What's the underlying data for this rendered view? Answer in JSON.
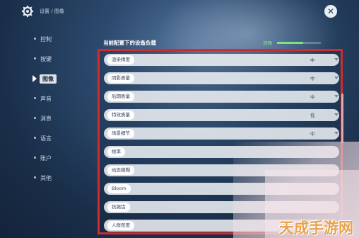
{
  "header": {
    "breadcrumb": "设置 / 图像",
    "close_glyph": "✕"
  },
  "sidebar": {
    "items": [
      {
        "label": "控制",
        "active": false
      },
      {
        "label": "按键",
        "active": false
      },
      {
        "label": "图像",
        "active": true
      },
      {
        "label": "声音",
        "active": false
      },
      {
        "label": "消息",
        "active": false
      },
      {
        "label": "语言",
        "active": false
      },
      {
        "label": "账户",
        "active": false
      },
      {
        "label": "其他",
        "active": false
      }
    ]
  },
  "main": {
    "section_title": "当前配置下的设备负载",
    "load_label": "流畅",
    "load_level": 0.6,
    "settings": [
      {
        "name": "渲染精度",
        "value": "中",
        "dropdown": true
      },
      {
        "name": "阴影质量",
        "value": "中",
        "dropdown": true
      },
      {
        "name": "后期质量",
        "value": "中",
        "dropdown": true
      },
      {
        "name": "特效质量",
        "value": "低",
        "dropdown": true
      },
      {
        "name": "场景细节",
        "value": "中",
        "dropdown": true
      },
      {
        "name": "帧率",
        "value": "",
        "dropdown": false
      },
      {
        "name": "动态模糊",
        "value": "",
        "dropdown": false
      },
      {
        "name": "Bloom",
        "value": "",
        "dropdown": false
      },
      {
        "name": "抗锯齿",
        "value": "",
        "dropdown": false
      },
      {
        "name": "人群密度",
        "value": "",
        "dropdown": false
      }
    ]
  },
  "watermark": "天成手游网",
  "colors": {
    "highlight_border": "#d22b2b",
    "load_bar": "#7fe07f",
    "watermark": "#e9a24a"
  }
}
